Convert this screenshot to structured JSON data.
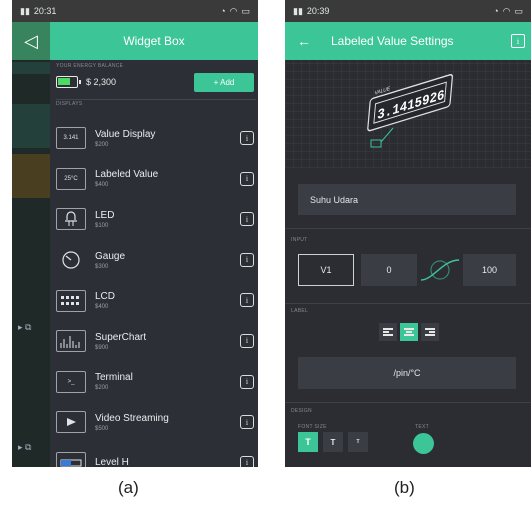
{
  "phone_a": {
    "status": {
      "time": "20:31"
    },
    "title": "Widget Box",
    "energy": {
      "label": "YOUR ENERGY BALANCE",
      "value": "$ 2,300",
      "fill_fraction": 0.7
    },
    "add_label": "+ Add",
    "section_label": "DISPLAYS",
    "widgets": [
      {
        "name": "Value Display",
        "cost": "$200",
        "icon": "3.141"
      },
      {
        "name": "Labeled Value",
        "cost": "$400",
        "icon": "25°C"
      },
      {
        "name": "LED",
        "cost": "$100",
        "icon": "led-icon"
      },
      {
        "name": "Gauge",
        "cost": "$300",
        "icon": "gauge-icon"
      },
      {
        "name": "LCD",
        "cost": "$400",
        "icon": "lcd-icon"
      },
      {
        "name": "SuperChart",
        "cost": "$900",
        "icon": "chart-icon"
      },
      {
        "name": "Terminal",
        "cost": "$200",
        "icon": ">_"
      },
      {
        "name": "Video Streaming",
        "cost": "$500",
        "icon": "play-icon"
      },
      {
        "name": "Level H",
        "cost": "",
        "icon": "level-icon"
      }
    ]
  },
  "phone_b": {
    "status": {
      "time": "20:39"
    },
    "title": "Labeled Value Settings",
    "preview_label": "VALUE",
    "preview_value": "3.1415926",
    "name_value": "Suhu Udara",
    "input_label": "INPUT",
    "pin": "V1",
    "min": "0",
    "max": "100",
    "label_section": "LABEL",
    "label_value": "/pin/°C",
    "design_label": "DESIGN",
    "font_size_label": "FONT SIZE",
    "text_label": "TEXT",
    "font_sizes": [
      "T",
      "T",
      "T"
    ]
  },
  "captions": {
    "a": "(a)",
    "b": "(b)"
  },
  "colors": {
    "accent": "#3cc596",
    "panel": "#2d2f36",
    "field": "#3b3d44"
  }
}
